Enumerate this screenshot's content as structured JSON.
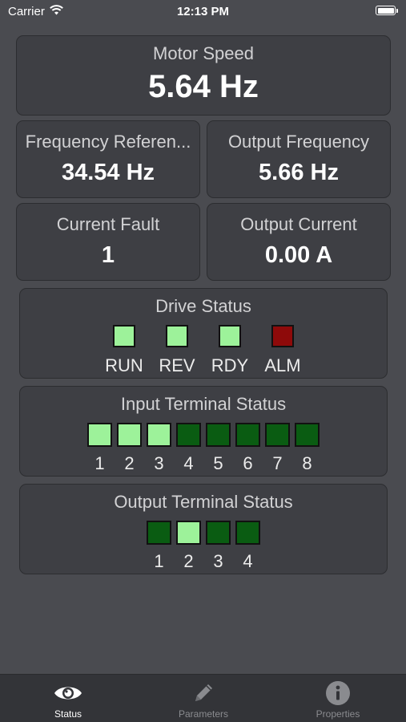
{
  "status_bar": {
    "carrier": "Carrier",
    "time": "12:13 PM"
  },
  "motor_speed": {
    "title": "Motor Speed",
    "value": "5.64 Hz"
  },
  "frequency_reference": {
    "title": "Frequency Referen...",
    "value": "34.54 Hz"
  },
  "output_frequency": {
    "title": "Output Frequency",
    "value": "5.66 Hz"
  },
  "current_fault": {
    "title": "Current Fault",
    "value": "1"
  },
  "output_current": {
    "title": "Output Current",
    "value": "0.00 A"
  },
  "drive_status": {
    "title": "Drive Status",
    "items": [
      {
        "label": "RUN",
        "state": "on"
      },
      {
        "label": "REV",
        "state": "on"
      },
      {
        "label": "RDY",
        "state": "on"
      },
      {
        "label": "ALM",
        "state": "alarm"
      }
    ]
  },
  "input_terminal_status": {
    "title": "Input Terminal Status",
    "terminals": [
      {
        "label": "1",
        "state": "on"
      },
      {
        "label": "2",
        "state": "on"
      },
      {
        "label": "3",
        "state": "on"
      },
      {
        "label": "4",
        "state": "off"
      },
      {
        "label": "5",
        "state": "off"
      },
      {
        "label": "6",
        "state": "off"
      },
      {
        "label": "7",
        "state": "off"
      },
      {
        "label": "8",
        "state": "off"
      }
    ]
  },
  "output_terminal_status": {
    "title": "Output Terminal Status",
    "terminals": [
      {
        "label": "1",
        "state": "off"
      },
      {
        "label": "2",
        "state": "on"
      },
      {
        "label": "3",
        "state": "off"
      },
      {
        "label": "4",
        "state": "off"
      }
    ]
  },
  "tab_bar": {
    "tabs": [
      {
        "label": "Status",
        "icon": "eye-icon",
        "active": true
      },
      {
        "label": "Parameters",
        "icon": "pencil-icon",
        "active": false
      },
      {
        "label": "Properties",
        "icon": "info-icon",
        "active": false
      }
    ]
  },
  "colors": {
    "led_on": "#9df29a",
    "led_off": "#0a5c12",
    "led_alarm": "#8e0a0a",
    "background": "#4a4b50",
    "card": "#3e3f44"
  }
}
